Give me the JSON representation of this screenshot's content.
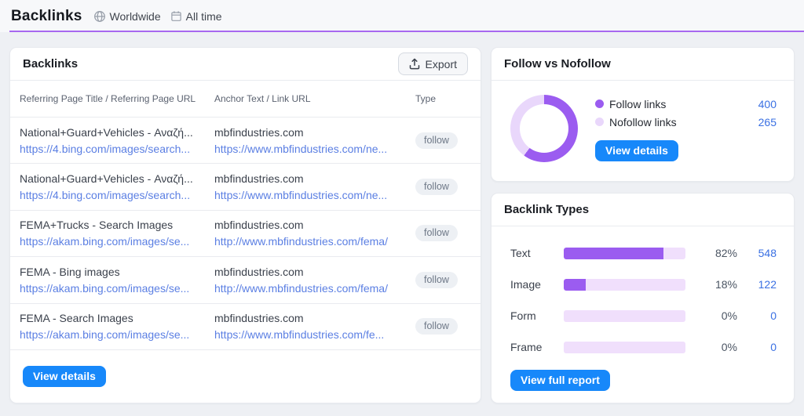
{
  "page": {
    "title": "Backlinks",
    "scope": "Worldwide",
    "period": "All time"
  },
  "colors": {
    "accent_purple": "#9b5cf0",
    "nofollow_light_purple": "#e9d7fb",
    "bar_track": "#f0dffc",
    "button_blue": "#1788fa",
    "link_blue": "#3a70e3",
    "url_blue": "#5b7fe3",
    "divider_purple": "#a768f0"
  },
  "backlinks_table": {
    "title": "Backlinks",
    "export_label": "Export",
    "columns": {
      "c1": "Referring Page Title / Referring Page URL",
      "c2": "Anchor Text / Link URL",
      "c3": "Type"
    },
    "rows": [
      {
        "title": "National+Guard+Vehicles - Αναζή...",
        "url": "https://4.bing.com/images/search...",
        "anchor": "mbfindustries.com",
        "link": "https://www.mbfindustries.com/ne...",
        "type": "follow"
      },
      {
        "title": "National+Guard+Vehicles - Αναζή...",
        "url": "https://4.bing.com/images/search...",
        "anchor": "mbfindustries.com",
        "link": "https://www.mbfindustries.com/ne...",
        "type": "follow"
      },
      {
        "title": "FEMA+Trucks - Search Images",
        "url": "https://akam.bing.com/images/se...",
        "anchor": "mbfindustries.com",
        "link": "http://www.mbfindustries.com/fema/",
        "type": "follow"
      },
      {
        "title": "FEMA - Bing images",
        "url": "https://akam.bing.com/images/se...",
        "anchor": "mbfindustries.com",
        "link": "http://www.mbfindustries.com/fema/",
        "type": "follow"
      },
      {
        "title": "FEMA - Search Images",
        "url": "https://akam.bing.com/images/se...",
        "anchor": "mbfindustries.com",
        "link": "https://www.mbfindustries.com/fe...",
        "type": "follow"
      }
    ],
    "view_details_label": "View details"
  },
  "follow_vs_nofollow": {
    "title": "Follow vs Nofollow",
    "legend": [
      {
        "label": "Follow links",
        "value": "400",
        "color": "#9b5cf0"
      },
      {
        "label": "Nofollow links",
        "value": "265",
        "color": "#e9d7fb"
      }
    ],
    "view_details_label": "View details"
  },
  "backlink_types": {
    "title": "Backlink Types",
    "rows": [
      {
        "label": "Text",
        "pct": "82%",
        "pct_value": 82,
        "count": "548"
      },
      {
        "label": "Image",
        "pct": "18%",
        "pct_value": 18,
        "count": "122"
      },
      {
        "label": "Form",
        "pct": "0%",
        "pct_value": 0,
        "count": "0"
      },
      {
        "label": "Frame",
        "pct": "0%",
        "pct_value": 0,
        "count": "0"
      }
    ],
    "view_full_report_label": "View full report"
  },
  "chart_data": [
    {
      "type": "pie",
      "title": "Follow vs Nofollow",
      "categories": [
        "Follow links",
        "Nofollow links"
      ],
      "values": [
        400,
        265
      ],
      "colors": [
        "#9b5cf0",
        "#e9d7fb"
      ],
      "legend_position": "right",
      "style": "donut"
    },
    {
      "type": "bar",
      "title": "Backlink Types",
      "categories": [
        "Text",
        "Image",
        "Form",
        "Frame"
      ],
      "values": [
        82,
        18,
        0,
        0
      ],
      "counts": [
        548,
        122,
        0,
        0
      ],
      "xlabel": "",
      "ylabel": "",
      "xlim": [
        0,
        100
      ],
      "orientation": "horizontal"
    }
  ]
}
